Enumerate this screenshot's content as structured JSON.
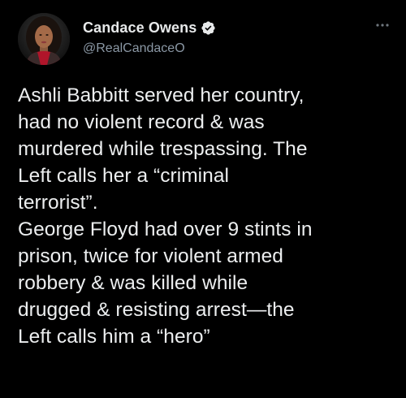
{
  "tweet": {
    "author": {
      "display_name": "Candace Owens",
      "handle": "@RealCandaceO",
      "verified": true,
      "avatar_icon": "profile-photo"
    },
    "more_icon": "more-options-icon",
    "text": "Ashli Babbitt served her country,\nhad no violent record & was\nmurdered while trespassing. The\nLeft calls her a “criminal\nterrorist”.\nGeorge Floyd had over 9 stints in\nprison, twice for violent armed\nrobbery & was killed while\ndrugged & resisting arrest—the\nLeft calls him a “hero”"
  },
  "colors": {
    "background": "#000000",
    "text_primary": "#e7e9ea",
    "text_secondary": "#8b98a5",
    "verified_badge": "#e7e9ea"
  }
}
